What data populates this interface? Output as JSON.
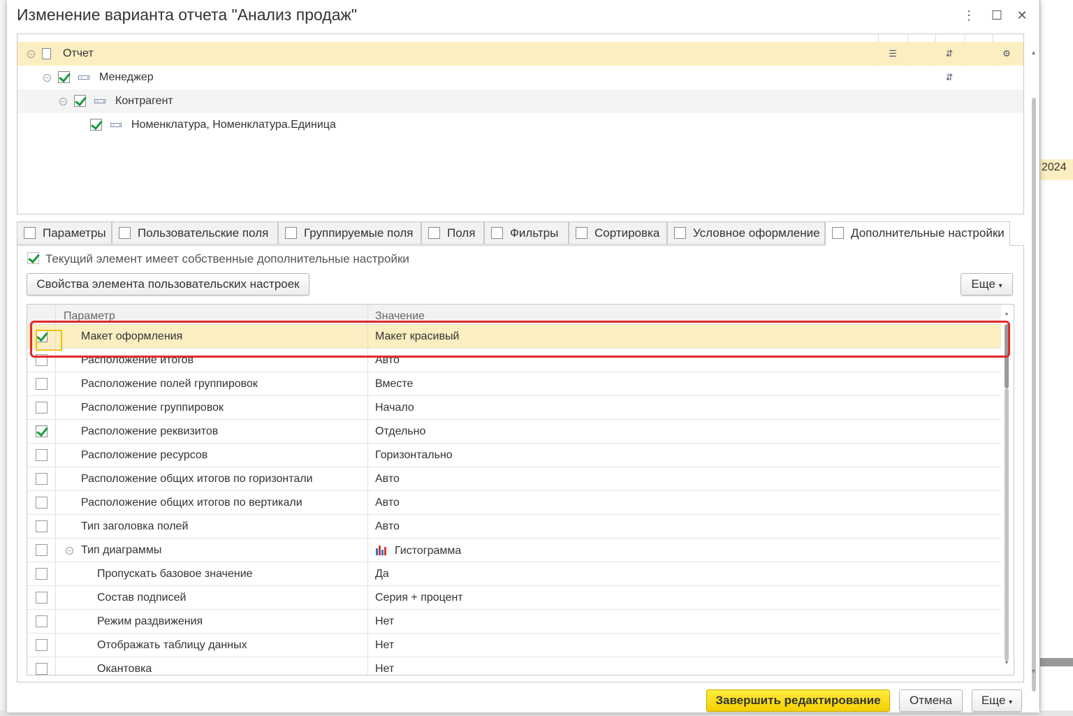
{
  "dialog": {
    "title": "Изменение варианта отчета \"Анализ продаж\"",
    "controls": {
      "menu": "⋮",
      "maximize": "☐",
      "close": "✕"
    }
  },
  "structure_tree": {
    "rows": [
      {
        "label": "Отчет",
        "level": 0,
        "checked": null,
        "selected": true
      },
      {
        "label": "Менеджер",
        "level": 1,
        "checked": true
      },
      {
        "label": "Контрагент",
        "level": 2,
        "checked": true
      },
      {
        "label": "Номенклатура, Номенклатура.Единица",
        "level": 3,
        "checked": true
      }
    ]
  },
  "tabs": [
    {
      "label": "Параметры",
      "icon": "parameters-icon"
    },
    {
      "label": "Пользовательские поля",
      "icon": "user-fields-icon"
    },
    {
      "label": "Группируемые поля",
      "icon": "grouped-fields-icon"
    },
    {
      "label": "Поля",
      "icon": "fields-icon"
    },
    {
      "label": "Фильтры",
      "icon": "filter-icon"
    },
    {
      "label": "Сортировка",
      "icon": "sort-icon"
    },
    {
      "label": "Условное оформление",
      "icon": "conditional-format-icon"
    },
    {
      "label": "Дополнительные настройки",
      "icon": "settings-icon",
      "active": true
    }
  ],
  "own_settings": {
    "label": "Текущий элемент имеет собственные дополнительные настройки",
    "checked": true
  },
  "buttons": {
    "user_settings_props": "Свойства элемента пользовательских настроек",
    "more_top": "Еще",
    "finish": "Завершить редактирование",
    "cancel": "Отмена",
    "more_bottom": "Еще"
  },
  "table": {
    "headers": {
      "param": "Параметр",
      "value": "Значение"
    },
    "rows": [
      {
        "param": "Макет оформления",
        "value": "Макет красивый",
        "checked": true,
        "selected": true,
        "indent": 0
      },
      {
        "param": "Расположение итогов",
        "value": "Авто",
        "checked": false,
        "indent": 0
      },
      {
        "param": "Расположение полей группировок",
        "value": "Вместе",
        "checked": false,
        "indent": 0
      },
      {
        "param": "Расположение группировок",
        "value": "Начало",
        "checked": false,
        "indent": 0
      },
      {
        "param": "Расположение реквизитов",
        "value": "Отдельно",
        "checked": true,
        "indent": 0
      },
      {
        "param": "Расположение ресурсов",
        "value": "Горизонтально",
        "checked": false,
        "indent": 0
      },
      {
        "param": "Расположение общих итогов по горизонтали",
        "value": "Авто",
        "checked": false,
        "indent": 0
      },
      {
        "param": "Расположение общих итогов по вертикали",
        "value": "Авто",
        "checked": false,
        "indent": 0
      },
      {
        "param": "Тип заголовка полей",
        "value": "Авто",
        "checked": false,
        "indent": 0
      },
      {
        "param": "Тип диаграммы",
        "value": "Гистограмма",
        "checked": false,
        "indent": 0,
        "expander": true,
        "icon": "bar-chart-icon"
      },
      {
        "param": "Пропускать базовое значение",
        "value": "Да",
        "checked": false,
        "indent": 1
      },
      {
        "param": "Состав подписей",
        "value": "Серия + процент",
        "checked": false,
        "indent": 1
      },
      {
        "param": "Режим раздвижения",
        "value": "Нет",
        "checked": false,
        "indent": 1
      },
      {
        "param": "Отображать таблицу данных",
        "value": "Нет",
        "checked": false,
        "indent": 1
      },
      {
        "param": "Окантовка",
        "value": "Нет",
        "checked": false,
        "indent": 1
      }
    ]
  },
  "background": {
    "right_value": "2024"
  }
}
